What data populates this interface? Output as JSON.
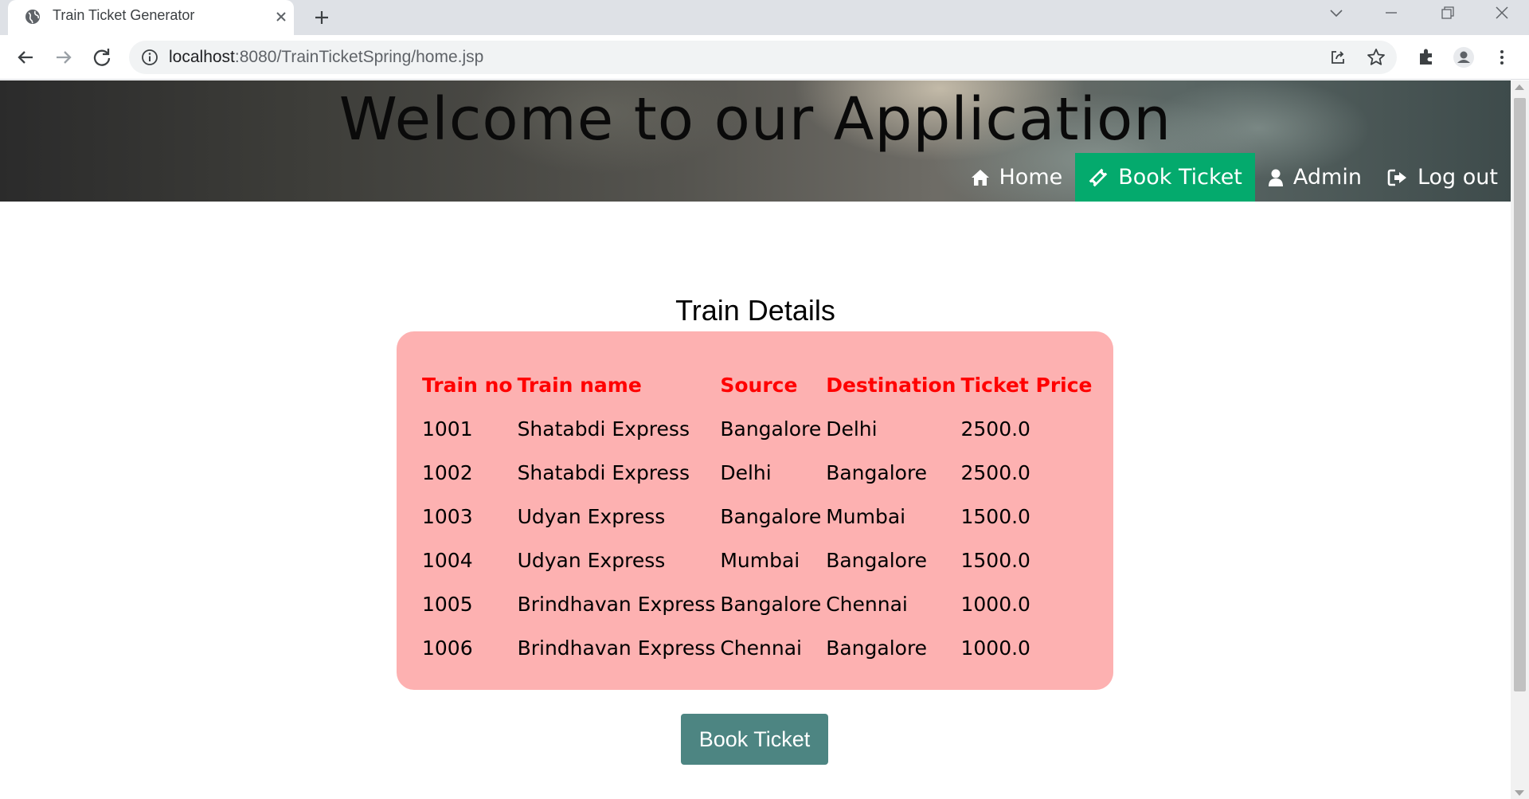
{
  "browser": {
    "tab_title": "Train Ticket Generator",
    "url_host": "localhost",
    "url_path": ":8080/TrainTicketSpring/home.jsp"
  },
  "header": {
    "title": "Welcome to our Application",
    "nav": [
      {
        "label": "Home",
        "icon": "home-icon",
        "active": false
      },
      {
        "label": "Book Ticket",
        "icon": "ticket-icon",
        "active": true
      },
      {
        "label": "Admin",
        "icon": "user-icon",
        "active": false
      },
      {
        "label": "Log out",
        "icon": "sign-out-icon",
        "active": false
      }
    ]
  },
  "main": {
    "title": "Train Details",
    "table": {
      "columns": [
        "Train no",
        "Train name",
        "Source",
        "Destination",
        "Ticket Price"
      ],
      "rows": [
        [
          "1001",
          "Shatabdi Express",
          "Bangalore",
          "Delhi",
          "2500.0"
        ],
        [
          "1002",
          "Shatabdi Express",
          "Delhi",
          "Bangalore",
          "2500.0"
        ],
        [
          "1003",
          "Udyan Express",
          "Bangalore",
          "Mumbai",
          "1500.0"
        ],
        [
          "1004",
          "Udyan Express",
          "Mumbai",
          "Bangalore",
          "1500.0"
        ],
        [
          "1005",
          "Brindhavan Express",
          "Bangalore",
          "Chennai",
          "1000.0"
        ],
        [
          "1006",
          "Brindhavan Express",
          "Chennai",
          "Bangalore",
          "1000.0"
        ]
      ]
    },
    "book_button": "Book Ticket"
  },
  "colors": {
    "nav_active": "#04aa6d",
    "card_bg": "#fdb1b1",
    "header_text": "#ff0000",
    "button_bg": "#4d8582"
  }
}
